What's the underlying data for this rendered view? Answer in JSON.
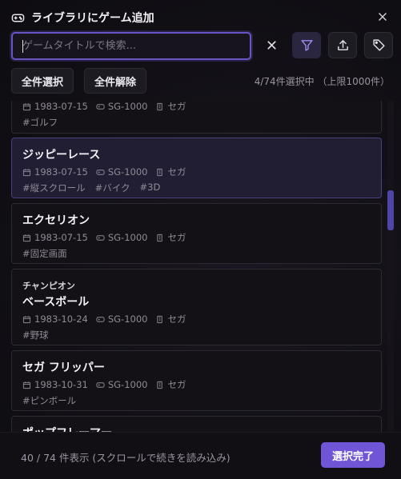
{
  "dialog": {
    "title": "ライブラリにゲーム追加",
    "title_icon": "gamepad-icon",
    "close_icon": "close-icon"
  },
  "search": {
    "placeholder": "ゲームタイトルで検索...",
    "value": ""
  },
  "toolbar": {
    "clear_icon": "close-icon",
    "filter_icon": "filter-icon",
    "export_icon": "upload-icon",
    "tag_icon": "tag-icon"
  },
  "selection": {
    "select_all": "全件選択",
    "deselect_all": "全件解除",
    "count_text": "4/74件選択中 （上限1000件）"
  },
  "games": [
    {
      "prefix": "",
      "name": "",
      "date": "1983-07-15",
      "platform": "SG-1000",
      "maker": "セガ",
      "tags": [
        "#ゴルフ"
      ],
      "selected": false
    },
    {
      "prefix": "",
      "name": "ジッピーレース",
      "date": "1983-07-15",
      "platform": "SG-1000",
      "maker": "セガ",
      "tags": [
        "#縦スクロール",
        "#バイク",
        "#3D"
      ],
      "selected": true
    },
    {
      "prefix": "",
      "name": "エクセリオン",
      "date": "1983-07-15",
      "platform": "SG-1000",
      "maker": "セガ",
      "tags": [
        "#固定画面"
      ],
      "selected": false
    },
    {
      "prefix": "チャンピオン",
      "name": "ベースボール",
      "date": "1983-10-24",
      "platform": "SG-1000",
      "maker": "セガ",
      "tags": [
        "#野球"
      ],
      "selected": false
    },
    {
      "prefix": "",
      "name": "セガ フリッパー",
      "date": "1983-10-31",
      "platform": "SG-1000",
      "maker": "セガ",
      "tags": [
        "#ピンボール"
      ],
      "selected": false
    },
    {
      "prefix": "",
      "name": "ポップフレーマー",
      "date": "",
      "platform": "",
      "maker": "",
      "tags": [],
      "selected": false
    }
  ],
  "footer": {
    "status": "40 / 74 件表示 (スクロールで続きを読み込み)",
    "done": "選択完了"
  },
  "colors": {
    "accent": "#7056d6",
    "selected_bg": "#211d33",
    "scroll_thumb": "#4e46a6"
  }
}
